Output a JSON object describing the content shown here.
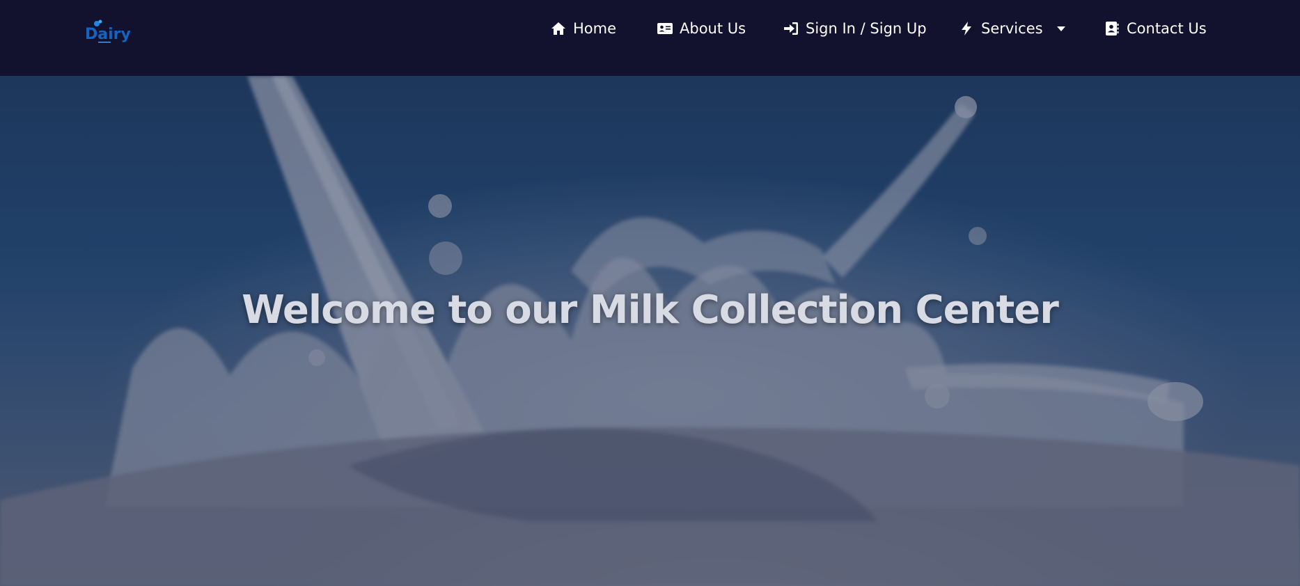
{
  "brand": {
    "logo_text": "Dairy",
    "logo_color": "#1565c0"
  },
  "nav": {
    "items": [
      {
        "label": "Home",
        "icon": "home-icon"
      },
      {
        "label": "About Us",
        "icon": "id-card-icon"
      },
      {
        "label": "Sign In / Sign Up",
        "icon": "sign-in-icon"
      },
      {
        "label": "Services",
        "icon": "bolt-icon",
        "dropdown": true
      },
      {
        "label": "Contact Us",
        "icon": "address-book-icon"
      }
    ]
  },
  "hero": {
    "title": "Welcome to our Milk Collection Center",
    "background_color": "#244a75"
  },
  "colors": {
    "navbar": "#12112e",
    "nav_text": "#ffffff",
    "title_text": "#d8dbe4"
  }
}
